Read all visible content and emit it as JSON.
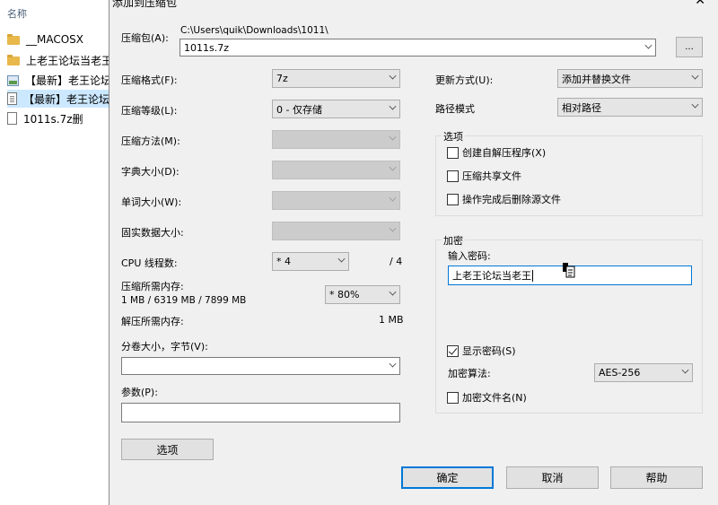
{
  "explorer": {
    "column_header": "名称",
    "files": [
      {
        "name": "__MACOSX",
        "icon": "folder-icon"
      },
      {
        "name": "上老王论坛当老王",
        "icon": "folder-icon"
      },
      {
        "name": "【最新】老王论坛",
        "icon": "image-file-icon"
      },
      {
        "name": "【最新】老王论坛",
        "icon": "document-icon"
      },
      {
        "name": "1011s.7z删",
        "icon": "blank-file-icon"
      }
    ]
  },
  "dialog": {
    "title": "添加到压缩包",
    "archive_label": "压缩包(A):",
    "archive_path": "C:\\Users\\quik\\Downloads\\1011\\",
    "archive_name": "1011s.7z",
    "browse_label": "...",
    "format_label": "压缩格式(F):",
    "format_value": "7z",
    "level_label": "压缩等级(L):",
    "level_value": "0 - 仅存储",
    "method_label": "压缩方法(M):",
    "dict_label": "字典大小(D):",
    "word_label": "单词大小(W):",
    "solid_label": "固实数据大小:",
    "cpu_label": "CPU 线程数:",
    "cpu_value": "* 4",
    "cpu_total": "/ 4",
    "mem_comp_label": "压缩所需内存:",
    "mem_comp_value": "1 MB / 6319 MB / 7899 MB",
    "mem_percent": "* 80%",
    "mem_decomp_label": "解压所需内存:",
    "mem_decomp_value": "1 MB",
    "split_label": "分卷大小，字节(V):",
    "split_value": "",
    "params_label": "参数(P):",
    "params_value": "",
    "options_button": "选项",
    "update_label": "更新方式(U):",
    "update_value": "添加并替换文件",
    "path_label": "路径模式",
    "path_value": "相对路径",
    "options_group": "选项",
    "opt_sfx": "创建自解压程序(X)",
    "opt_shared": "压缩共享文件",
    "opt_delete": "操作完成后删除源文件",
    "encrypt_group": "加密",
    "password_label": "输入密码:",
    "password_value": "上老王论坛当老王",
    "show_password": "显示密码(S)",
    "enc_method_label": "加密算法:",
    "enc_method_value": "AES-256",
    "encrypt_names": "加密文件名(N)",
    "ok": "确定",
    "cancel": "取消",
    "help": "帮助"
  }
}
